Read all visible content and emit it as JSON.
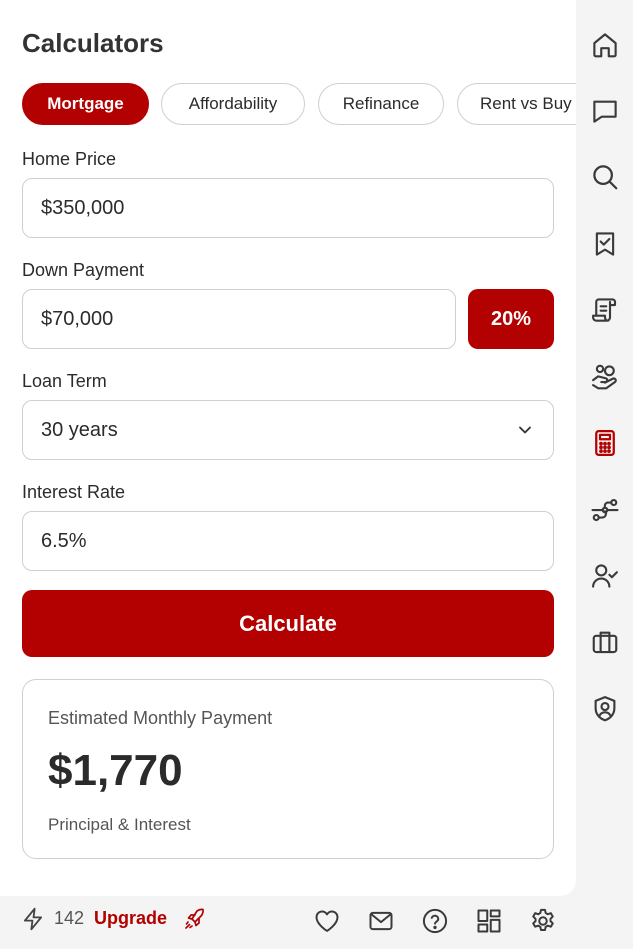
{
  "colors": {
    "accent": "#b30000"
  },
  "page": {
    "title": "Calculators"
  },
  "tabs": [
    {
      "label": "Mortgage",
      "active": true
    },
    {
      "label": "Affordability",
      "active": false
    },
    {
      "label": "Refinance",
      "active": false
    },
    {
      "label": "Rent vs Buy",
      "active": false
    }
  ],
  "form": {
    "home_price": {
      "label": "Home Price",
      "value": "$350,000"
    },
    "down_payment": {
      "label": "Down Payment",
      "value": "$70,000",
      "percent": "20%"
    },
    "loan_term": {
      "label": "Loan Term",
      "value": "30 years"
    },
    "interest_rate": {
      "label": "Interest Rate",
      "value": "6.5%"
    },
    "calculate_label": "Calculate"
  },
  "result": {
    "label": "Estimated Monthly Payment",
    "value": "$1,770",
    "sub": "Principal & Interest"
  },
  "rail": [
    {
      "icon": "home-icon"
    },
    {
      "icon": "chat-icon"
    },
    {
      "icon": "search-icon"
    },
    {
      "icon": "bookmark-check-icon"
    },
    {
      "icon": "scroll-icon"
    },
    {
      "icon": "hand-coins-icon"
    },
    {
      "icon": "calculator-icon",
      "active": true
    },
    {
      "icon": "route-icon"
    },
    {
      "icon": "user-check-icon"
    },
    {
      "icon": "briefcase-icon"
    },
    {
      "icon": "shield-user-icon"
    }
  ],
  "bottom": {
    "credits": "142",
    "upgrade_label": "Upgrade",
    "icons": [
      "heart-icon",
      "mail-icon",
      "help-icon",
      "grid-icon",
      "settings-icon"
    ]
  }
}
